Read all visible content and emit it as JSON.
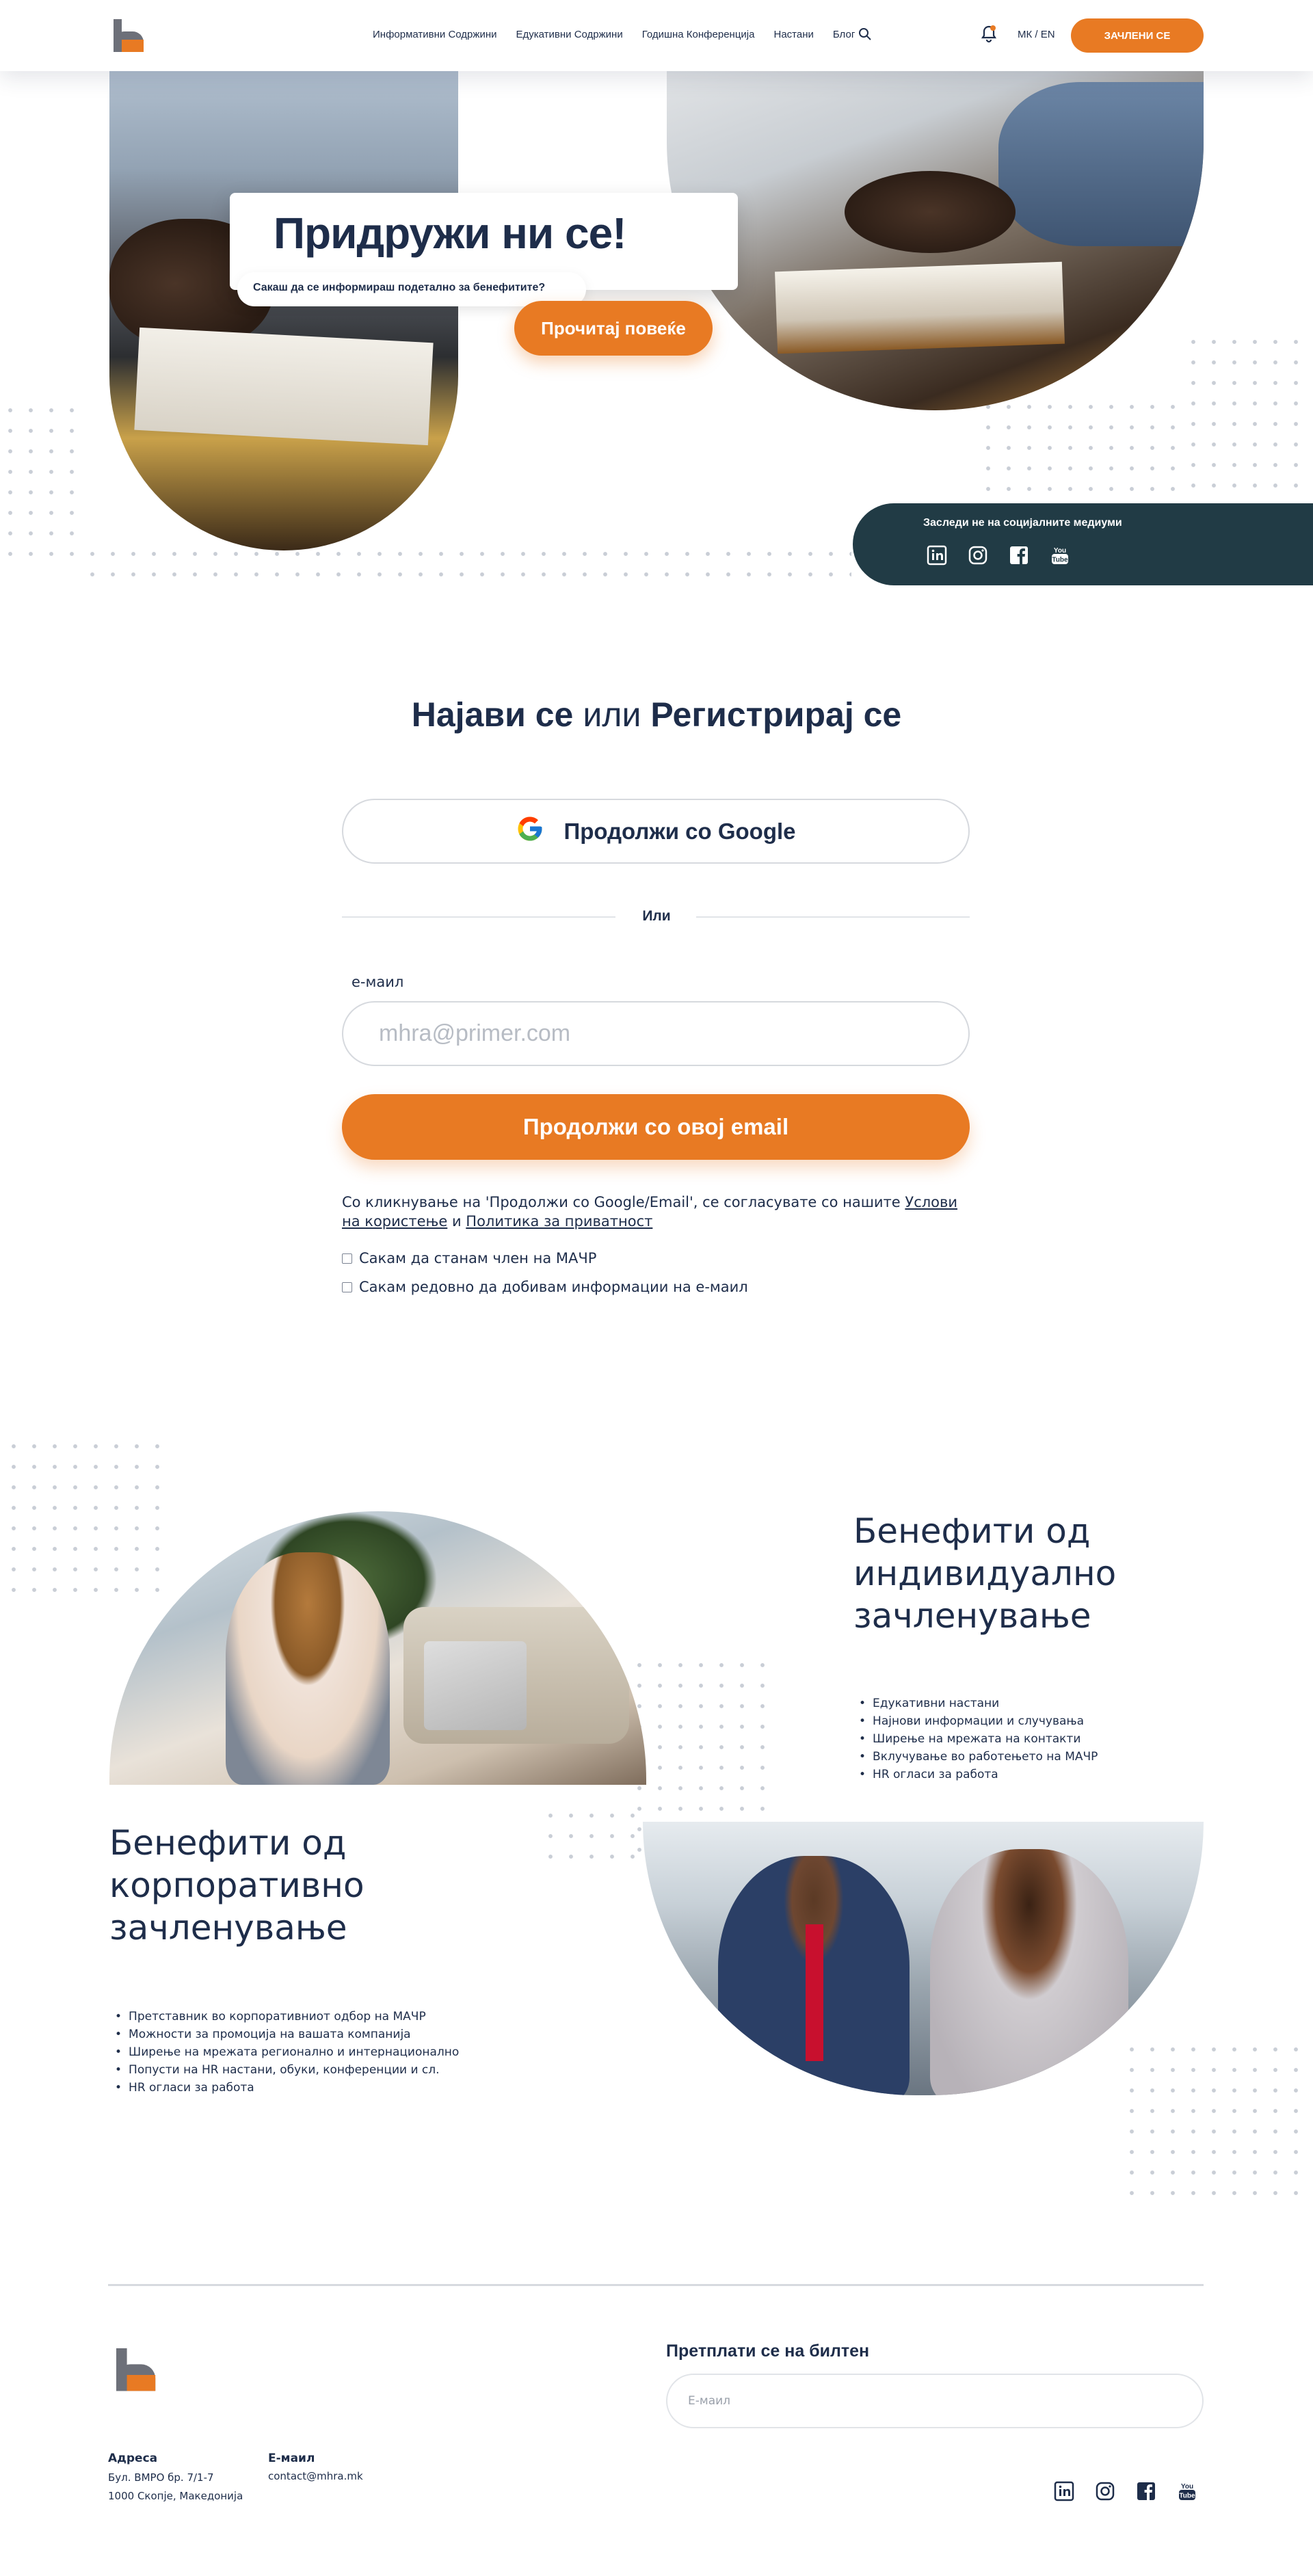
{
  "header": {
    "nav": [
      "Информативни Содржини",
      "Едукативни Содржини",
      "Годишна Конференција",
      "Настани",
      "Блог"
    ],
    "lang": "МК / EN",
    "join_label": "ЗАЧЛЕНИ СЕ"
  },
  "hero": {
    "title": "Придружи ни се!",
    "subtitle": "Сакаш да се информираш подетално за бенефитите?",
    "read_more": "Прочитај повеќе",
    "social_title": "Заследи не на социјалните медиуми",
    "social_icons": [
      "linkedin-icon",
      "instagram-icon",
      "facebook-icon",
      "youtube-icon"
    ]
  },
  "login": {
    "title_login": "Најави се",
    "title_or": "или",
    "title_register": "Регистрирај се",
    "google_label": "Продолжи со Google",
    "divider": "Или",
    "email_label": "е-маил",
    "email_placeholder": "mhra@primer.com",
    "email_button": "Продолжи со овој email",
    "terms_prefix": "Со кликнување на 'Продолжи со Google/Email', се согласувате со нашите ",
    "terms_link": "Услови на користење",
    "terms_and": " и ",
    "privacy_link": "Политика за приватност",
    "checkbox_member": "Сакам да станам член на МАЧР",
    "checkbox_news": "Сакам редовно да добивам информации на е-маил"
  },
  "benefits": {
    "individual_title": "Бенефити од индивидуално зачленување",
    "individual_items": [
      "Едукативни настани",
      "Најнови информации и случувања",
      "Ширење на мрежата на контакти",
      "Вклучување во работењето на МАЧР",
      "HR огласи за работа"
    ],
    "corporate_title": "Бенефити од корпоративно зачленување",
    "corporate_items": [
      "Претставник во корпоративниот одбор на МАЧР",
      "Можности за промоција на вашата компанија",
      "Ширење на мрежата регионално и интернационално",
      "Попусти на HR настани, обуки, конференции и сл.",
      "HR огласи за работа"
    ]
  },
  "footer": {
    "newsletter_title": "Претплати се на билтен",
    "newsletter_placeholder": "Е-маил",
    "address_label": "Адреса",
    "address_line1": "Бул. ВМРО бр. 7/1-7",
    "address_line2": "1000 Скопје, Македонија",
    "email_label": "Е-маил",
    "email_value": "contact@mhra.mk"
  },
  "colors": {
    "brand_orange": "#e87a23",
    "navy": "#1e2d4a",
    "social_panel": "#213b45"
  }
}
